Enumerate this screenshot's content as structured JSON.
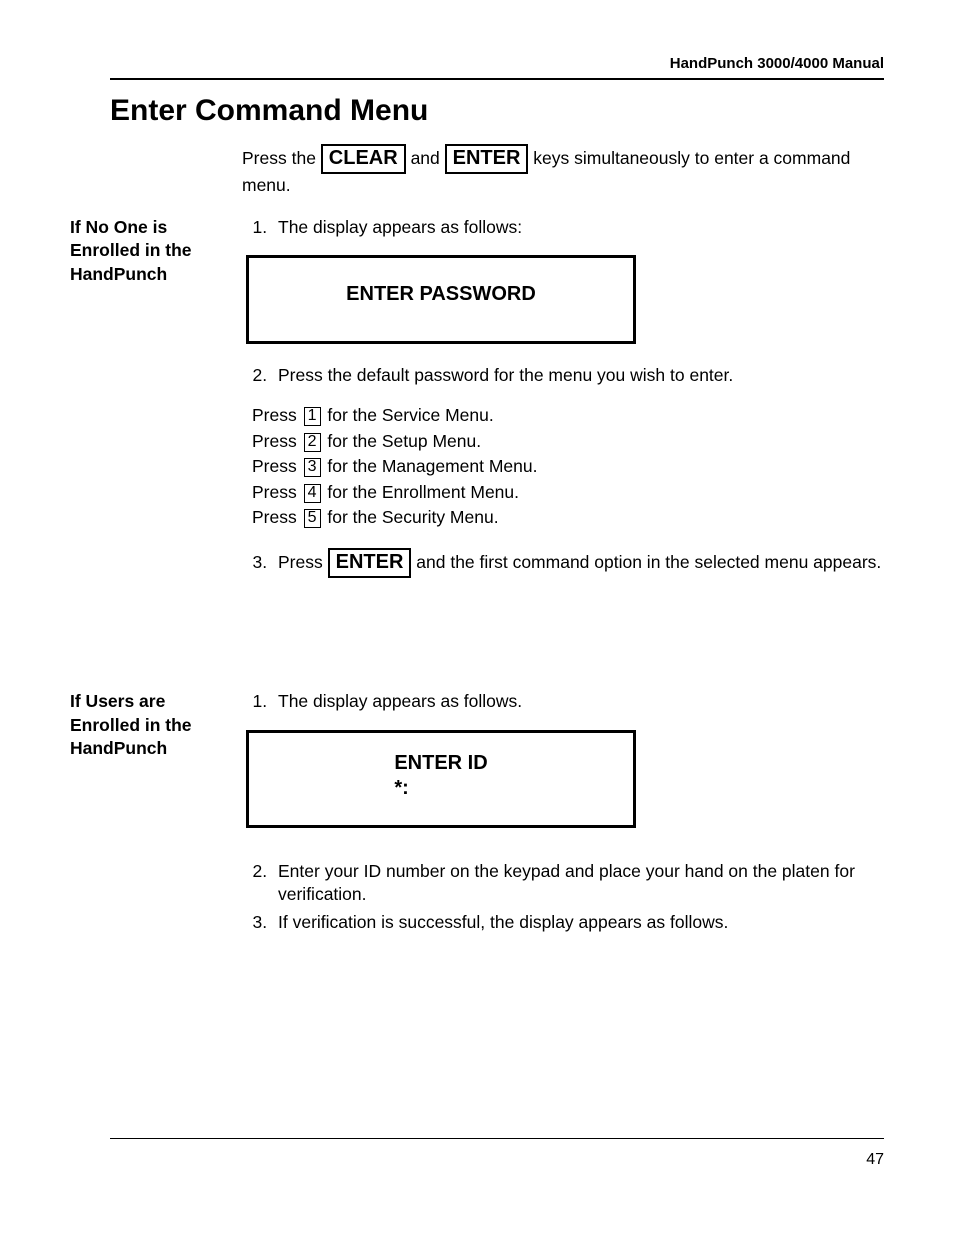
{
  "header": {
    "running": "HandPunch 3000/4000 Manual"
  },
  "title": "Enter Command Menu",
  "intro": {
    "pre": "Press the ",
    "key1": "CLEAR",
    "mid": " and ",
    "key2": "ENTER",
    "post": "  keys simultaneously to enter a command menu."
  },
  "section1": {
    "side": "If No One is Enrolled in the HandPunch",
    "step1": "The display appears as follows:",
    "display": "ENTER PASSWORD",
    "step2": "Press the default password for the menu you wish to enter.",
    "menus": [
      {
        "pre": "Press ",
        "digit": "1",
        "post": " for the Service Menu."
      },
      {
        "pre": "Press ",
        "digit": "2",
        "post": " for the Setup Menu."
      },
      {
        "pre": "Press ",
        "digit": "3",
        "post": " for the Management Menu."
      },
      {
        "pre": "Press ",
        "digit": "4",
        "post": " for the Enrollment Menu."
      },
      {
        "pre": "Press ",
        "digit": "5",
        "post": " for the Security Menu."
      }
    ],
    "step3_pre": "Press  ",
    "step3_key": "ENTER",
    "step3_post": " and the first command option in the selected menu appears."
  },
  "section2": {
    "side": "If Users are Enrolled in the HandPunch",
    "step1": "The display appears as follows.",
    "display_line1": "ENTER ID",
    "display_line2": "*:",
    "step2": "Enter your ID number on the keypad and place your hand on the platen for verification.",
    "step3": "If verification is successful, the display appears as follows."
  },
  "footer": {
    "page": "47"
  }
}
